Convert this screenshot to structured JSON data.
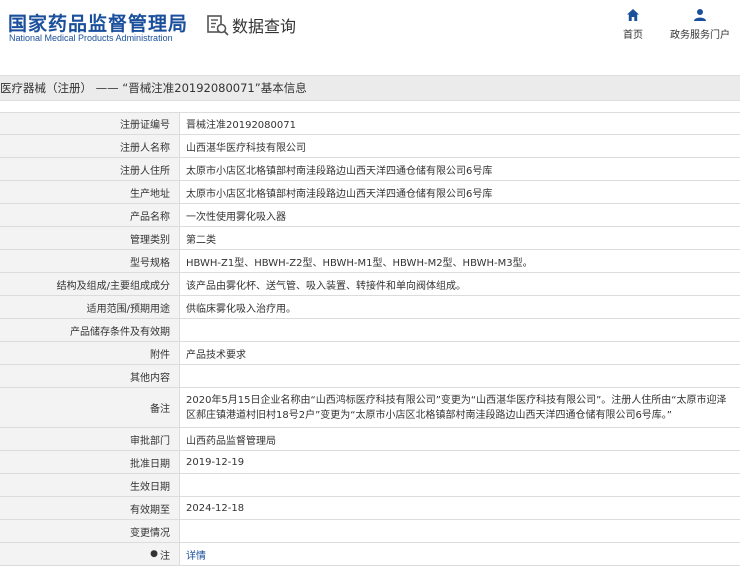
{
  "header": {
    "logo_cn": "国家药品监督管理局",
    "logo_en": "National Medical Products Administration",
    "section_title": "数据查询",
    "section_icon": "search-data-icon"
  },
  "nav": {
    "home": {
      "label": "首页",
      "icon": "home-icon"
    },
    "service": {
      "label": "政务服务门户",
      "icon": "user-icon"
    }
  },
  "breadcrumb_title": "医疗器械（注册） —— “晋械注准20192080071”基本信息",
  "fields": [
    {
      "label": "注册证编号",
      "value": "晋械注准20192080071"
    },
    {
      "label": "注册人名称",
      "value": "山西湛华医疗科技有限公司"
    },
    {
      "label": "注册人住所",
      "value": "太原市小店区北格镇部村南洼段路边山西天洋四通仓储有限公司6号库"
    },
    {
      "label": "生产地址",
      "value": "太原市小店区北格镇部村南洼段路边山西天洋四通仓储有限公司6号库"
    },
    {
      "label": "产品名称",
      "value": "一次性使用雾化吸入器"
    },
    {
      "label": "管理类别",
      "value": "第二类"
    },
    {
      "label": "型号规格",
      "value": "HBWH-Z1型、HBWH-Z2型、HBWH-M1型、HBWH-M2型、HBWH-M3型。"
    },
    {
      "label": "结构及组成/主要组成成分",
      "value": "该产品由雾化杯、送气管、吸入装置、转接件和单向阀体组成。"
    },
    {
      "label": "适用范围/预期用途",
      "value": "供临床雾化吸入治疗用。"
    },
    {
      "label": "产品储存条件及有效期",
      "value": ""
    },
    {
      "label": "附件",
      "value": "产品技术要求"
    },
    {
      "label": "其他内容",
      "value": ""
    },
    {
      "label": "备注",
      "value": "2020年5月15日企业名称由“山西鸿标医疗科技有限公司”变更为“山西湛华医疗科技有限公司”。注册人住所由“太原市迎泽区郝庄镇港道村旧村18号2户”变更为“太原市小店区北格镇部村南洼段路边山西天洋四通仓储有限公司6号库。”"
    },
    {
      "label": "审批部门",
      "value": "山西药品监督管理局"
    },
    {
      "label": "批准日期",
      "value": "2019-12-19"
    },
    {
      "label": "生效日期",
      "value": ""
    },
    {
      "label": "有效期至",
      "value": "2024-12-18"
    },
    {
      "label": "变更情况",
      "value": ""
    },
    {
      "label": "注",
      "value": "详情"
    }
  ],
  "colors": {
    "brand_blue": "#1a4f9c",
    "label_bg": "#f3f3f3",
    "border": "#dcdcdc"
  }
}
